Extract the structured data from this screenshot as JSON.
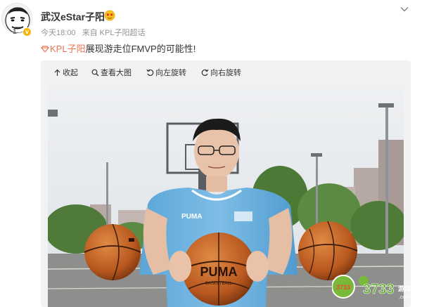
{
  "post": {
    "username": "武汉eStar子阳",
    "level": "1",
    "time": "今天18:00",
    "source": "来自 KPL子阳超话",
    "content_topic": "KPL子阳",
    "content_text": "展现游走位FMVP的可能性!"
  },
  "toolbar": {
    "collapse_label": "收起",
    "view_large_label": "查看大图",
    "rotate_left_label": "向左旋转",
    "rotate_right_label": "向右旋转"
  },
  "photo": {
    "shirt_brand": "PUMA",
    "ball_text_main": "PUMA",
    "ball_text_sub": "BASKETBALL"
  },
  "watermark": {
    "text_left": "3733",
    "text_right": "3733",
    "text_small": "游戏",
    "text_domain": ".com"
  },
  "colors": {
    "topic": "#eb7350",
    "username": "#333333",
    "meta": "#939393",
    "media_bg": "#f2f2f5"
  }
}
